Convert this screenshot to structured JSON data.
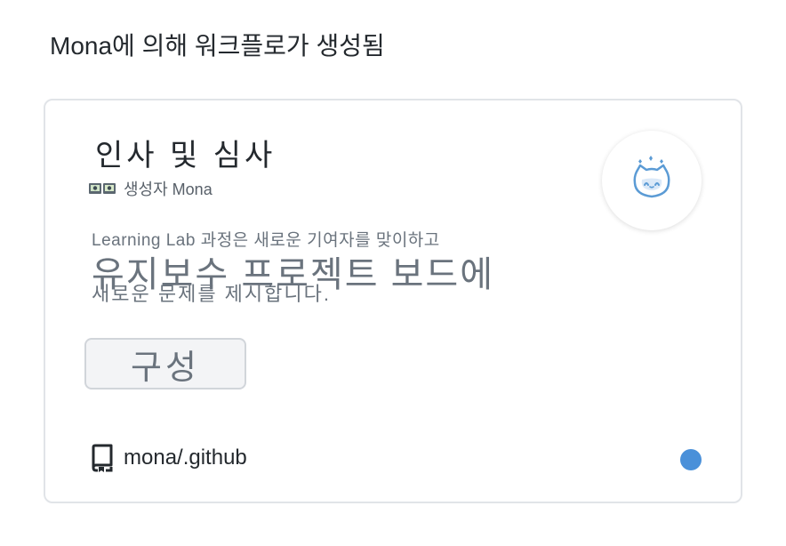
{
  "page": {
    "heading": "Mona에 의해 워크플로가 생성됨"
  },
  "card": {
    "title": "인사 및 심사",
    "creator_label": "생성자 Mona",
    "description_line1": "Learning  Lab 과정은 새로운 기여자를 맞이하고",
    "description_line2": "유지보수 프로젝트 보드에",
    "description_line3": "새로운 문제를 제시합니다.",
    "button_label": "구성",
    "repo_name": "mona/.github",
    "status_color": "#4a90d9",
    "avatar_icon": "octocat-mona-icon",
    "creator_icon": "creator-avatars-icon",
    "repo_icon": "repo-icon"
  }
}
